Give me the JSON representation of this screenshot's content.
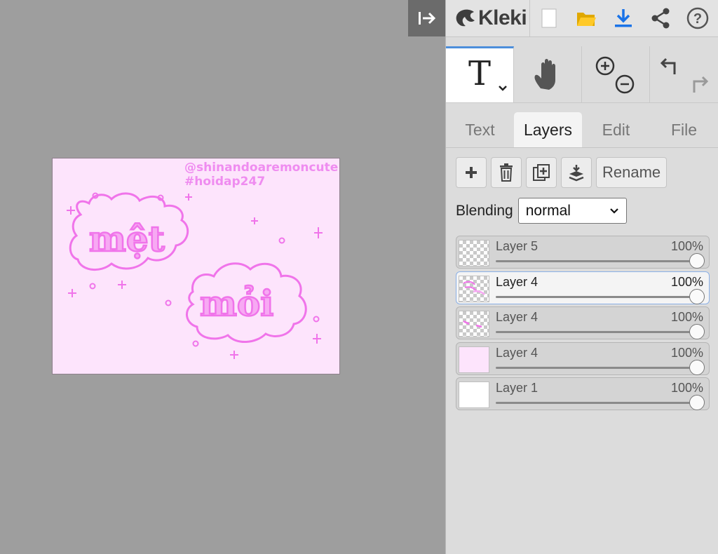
{
  "app": {
    "brand": "Kleki"
  },
  "artwork": {
    "credit": "@shinandoaremoncute\n#hoidap247",
    "word1": "mệt",
    "word2": "mỏi"
  },
  "tools": [
    {
      "name": "text-tool",
      "active": true
    },
    {
      "name": "hand-tool",
      "active": false
    },
    {
      "name": "zoom-tool",
      "active": false
    },
    {
      "name": "undo-redo",
      "active": false
    }
  ],
  "tabs": [
    "Text",
    "Layers",
    "Edit",
    "File"
  ],
  "active_tab": "Layers",
  "layer_actions": {
    "rename_label": "Rename"
  },
  "blending": {
    "label": "Blending",
    "value": "normal"
  },
  "layers": [
    {
      "name": "Layer 5",
      "opacity": "100%",
      "selected": false,
      "thumb": "transparent"
    },
    {
      "name": "Layer 4",
      "opacity": "100%",
      "selected": true,
      "thumb": "transparent"
    },
    {
      "name": "Layer 4",
      "opacity": "100%",
      "selected": false,
      "thumb": "transparent"
    },
    {
      "name": "Layer 4",
      "opacity": "100%",
      "selected": false,
      "thumb": "pink"
    },
    {
      "name": "Layer 1",
      "opacity": "100%",
      "selected": false,
      "thumb": "white"
    }
  ],
  "colors": {
    "accent": "#4c8edb",
    "art_bg": "#fde4fc",
    "art_pink": "#f074ea"
  }
}
